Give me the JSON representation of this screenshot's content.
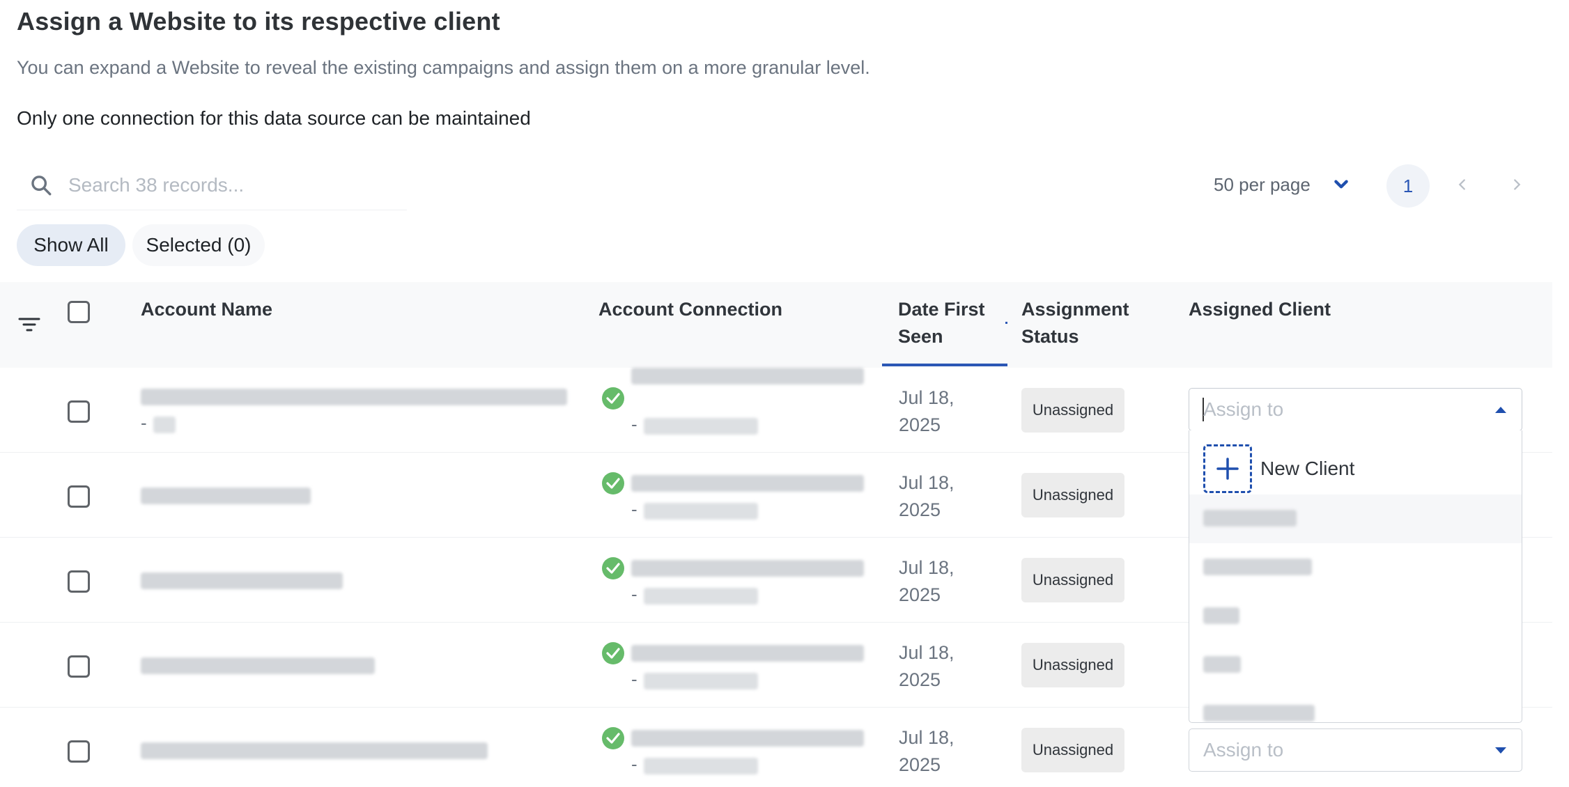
{
  "header": {
    "title": "Assign a Website to its respective client",
    "subtitle": "You can expand a Website to reveal the existing campaigns and assign them on a more granular level."
  },
  "notice": "Only one connection for this data source can be maintained",
  "search": {
    "placeholder": "Search 38 records..."
  },
  "pagination": {
    "per_page_label": "50 per page",
    "current_page": "1"
  },
  "filters": {
    "show_all": "Show All",
    "selected": "Selected (0)"
  },
  "table": {
    "columns": {
      "account_name": "Account Name",
      "account_connection": "Account Connection",
      "date_first_seen_1": "Date First",
      "date_first_seen_2": "Seen",
      "assignment_status_1": "Assignment",
      "assignment_status_2": "Status",
      "assigned_client": "Assigned Client"
    },
    "rows": [
      {
        "connection_prefix": "-",
        "account_suffix": "-",
        "date_line1": "Jul 18,",
        "date_line2": "2025",
        "status": "Unassigned",
        "assign_placeholder": "Assign to"
      },
      {
        "connection_prefix": "-",
        "date_line1": "Jul 18,",
        "date_line2": "2025",
        "status": "Unassigned"
      },
      {
        "connection_prefix": "-",
        "date_line1": "Jul 18,",
        "date_line2": "2025",
        "status": "Unassigned"
      },
      {
        "connection_prefix": "-",
        "date_line1": "Jul 18,",
        "date_line2": "2025",
        "status": "Unassigned"
      },
      {
        "connection_prefix": "-",
        "date_line1": "Jul 18,",
        "date_line2": "2025",
        "status": "Unassigned",
        "assign_placeholder": "Assign to"
      }
    ]
  },
  "dropdown": {
    "new_client_label": "New Client"
  },
  "colors": {
    "accent": "#1f4fae",
    "success": "#66bb6a",
    "badge_bg": "#ececec"
  },
  "icons": [
    "search-icon",
    "filter-lines-icon",
    "chevron-down-icon",
    "chevron-left-icon",
    "chevron-right-icon",
    "check-circle-icon",
    "caret-up-icon",
    "caret-down-icon",
    "plus-icon"
  ]
}
